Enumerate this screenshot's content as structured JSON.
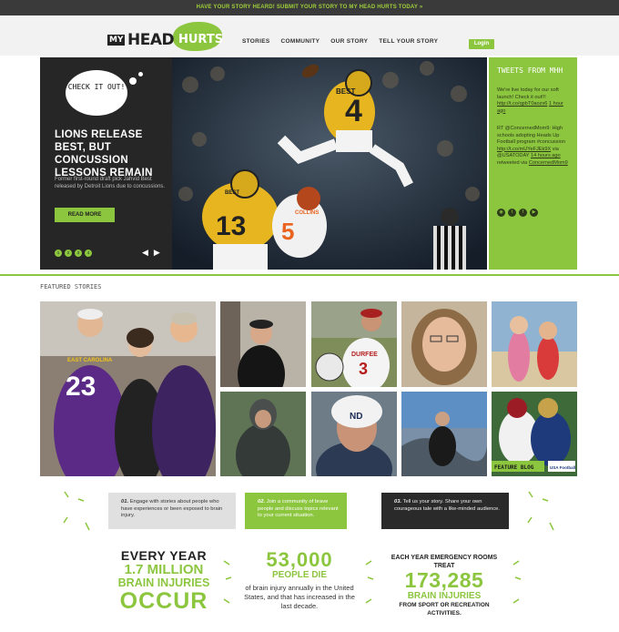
{
  "topbar": {
    "text": "HAVE YOUR STORY HEARD! SUBMIT YOUR STORY TO MY HEAD HURTS TODAY »"
  },
  "logo": {
    "my": "MY",
    "head": "HEAD",
    "hurts": "HURTS"
  },
  "nav": {
    "items": [
      "STORIES",
      "COMMUNITY",
      "OUR STORY",
      "TELL YOUR STORY"
    ]
  },
  "login_label": "Login",
  "hero": {
    "bubble_text": "CHECK IT OUT!",
    "title": "LIONS RELEASE BEST, BUT CONCUSSION LESSONS REMAIN",
    "description": "Former first-round draft pick Jahvid Best released by Detroit Lions due to concussions.",
    "read_more": "READ MORE",
    "pages": [
      "1",
      "2",
      "3",
      "4"
    ],
    "prev": "◀",
    "next": "▶",
    "jersey_front": "4",
    "jersey_front_name": "BEST",
    "jersey_back": "13",
    "jersey_back_name": "BEST",
    "jersey_orange": "5",
    "jersey_orange_name": "COLLINS"
  },
  "tweets": {
    "title": "TWEETS FROM MHH",
    "tweet1": "We're live today for our soft launch! Check it out!!!",
    "tweet1_link": "http://t.co/qpbT0aozx6",
    "tweet1_time": "1 hour ago",
    "tweet2": "RT @ConcernedMom9: High schools adopting Heads Up Football program #concussion",
    "tweet2_link": "http://t.co/mUYeFJEk9X",
    "tweet2_via": "via @USATODAY",
    "tweet2_time": "14 hours ago",
    "tweet2_retweet": "retweeted via",
    "tweet2_handle": "ConcernedMom9",
    "social": [
      "rss-icon",
      "twitter-icon",
      "facebook-icon",
      "youtube-icon"
    ]
  },
  "featured": {
    "label": "FEATURED STORIES",
    "big_jersey_school": "EAST CAROLINA",
    "big_jersey_number": "23",
    "durfee": "DURFEE",
    "durfee_number": "3",
    "nd": "ND",
    "blog_label": "FEATURE BLOG",
    "blog_badge": "USA Football"
  },
  "steps": [
    {
      "num": "01.",
      "text": "Engage with stories about people who have experiences or been exposed to brain injury."
    },
    {
      "num": "02.",
      "text": "Join a community of brave people and discuss topics relevant to your current situation."
    },
    {
      "num": "03.",
      "text": "Tell us your story. Share your own courageous tale with a like-minded audience."
    }
  ],
  "stats": {
    "s1_line1": "EVERY YEAR",
    "s1_line2": "1.7 MILLION",
    "s1_line3": "BRAIN INJURIES",
    "s1_line4": "OCCUR",
    "s2_number": "53,000",
    "s2_label": "PEOPLE DIE",
    "s2_text": "of brain injury annually in the United States, and that has increased in the last decade.",
    "s3_line1": "EACH YEAR EMERGENCY ROOMS TREAT",
    "s3_number": "173,285",
    "s3_label": "BRAIN INJURIES",
    "s3_sub": "FROM SPORT OR RECREATION ACTIVITIES."
  },
  "colors": {
    "accent": "#8cc63f",
    "dark": "#262626"
  }
}
